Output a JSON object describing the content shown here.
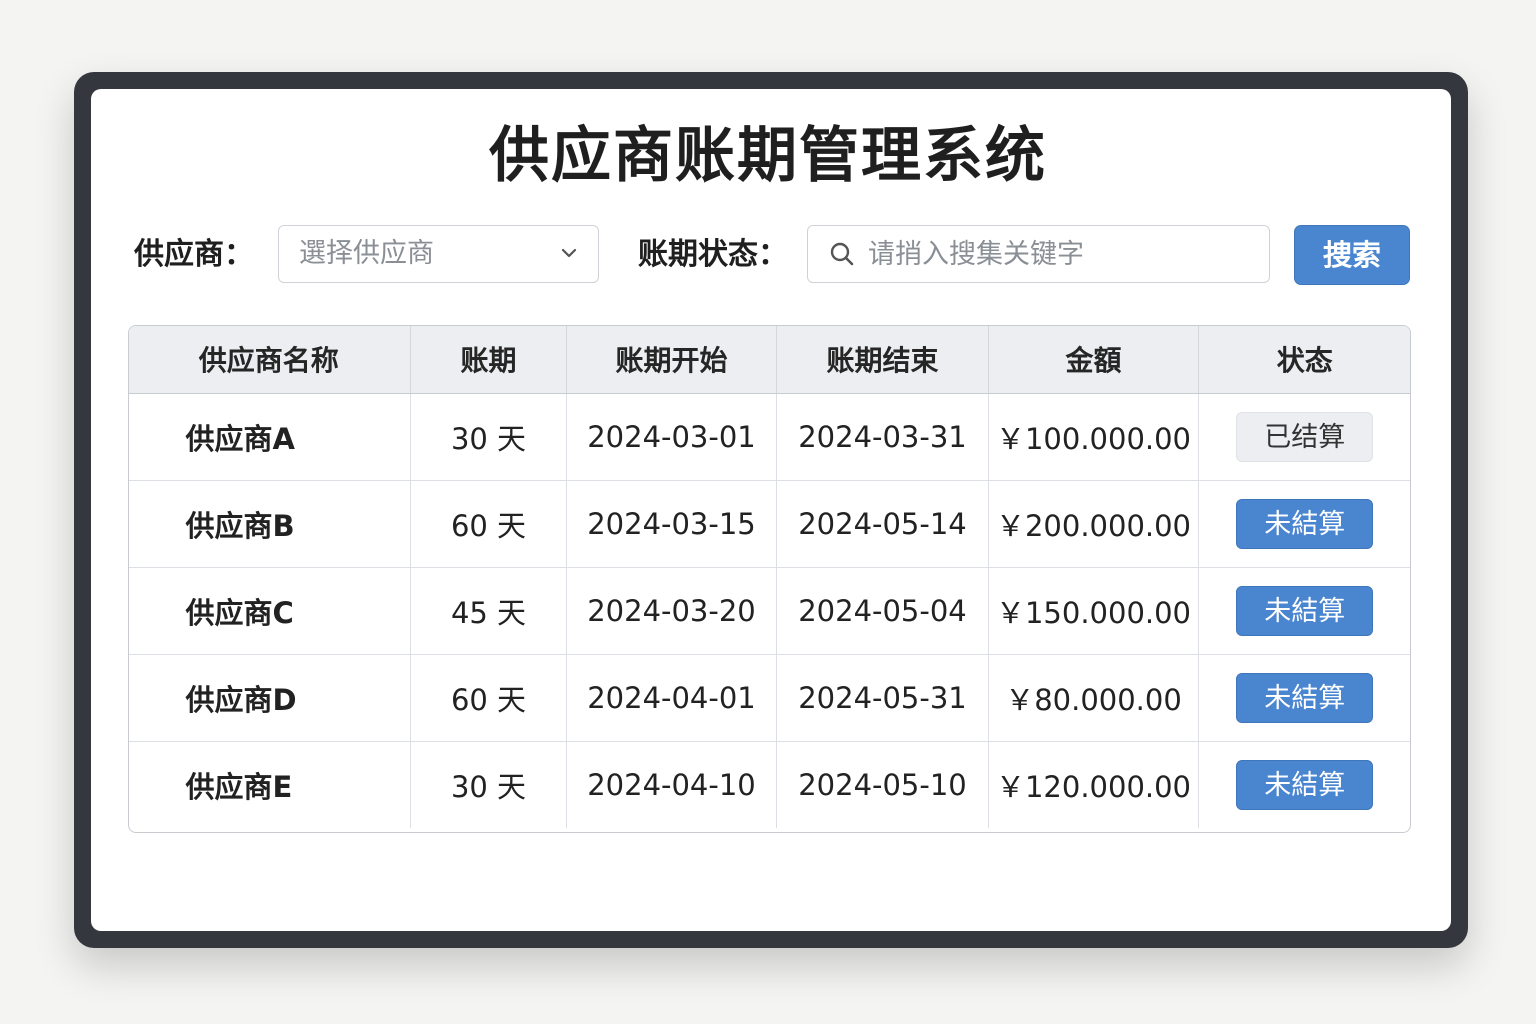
{
  "title": "供应商账期管理系统",
  "filters": {
    "supplier_label": "供应商：",
    "supplier_select_value": "選择供应商",
    "status_label": "账期状态：",
    "search_placeholder": "请捎入搜集关键字",
    "search_button": "捜索"
  },
  "table": {
    "headers": [
      "供应商名称",
      "账期",
      "账期开始",
      "账期结束",
      "金額",
      "状态"
    ],
    "rows": [
      {
        "name": "供应商A",
        "term": "30 天",
        "start": "2024-03-01",
        "end": "2024-03-31",
        "amount": "￥100.000.00",
        "status": "已结算",
        "status_kind": "done"
      },
      {
        "name": "供应商B",
        "term": "60 天",
        "start": "2024-03-15",
        "end": "2024-05-14",
        "amount": "￥200.000.00",
        "status": "未結算",
        "status_kind": "pending"
      },
      {
        "name": "供应商C",
        "term": "45 天",
        "start": "2024-03-20",
        "end": "2024-05-04",
        "amount": "￥150.000.00",
        "status": "未結算",
        "status_kind": "pending"
      },
      {
        "name": "供应商D",
        "term": "60 天",
        "start": "2024-04-01",
        "end": "2024-05-31",
        "amount": "￥80.000.00",
        "status": "未結算",
        "status_kind": "pending"
      },
      {
        "name": "供应商E",
        "term": "30 天",
        "start": "2024-04-10",
        "end": "2024-05-10",
        "amount": "￥120.000.00",
        "status": "未結算",
        "status_kind": "pending"
      }
    ]
  },
  "colors": {
    "accent": "#4a86d0",
    "frame": "#34373d",
    "header_bg": "#eceef1"
  },
  "icons": {
    "select": "chevron-down-icon",
    "search": "search-icon"
  }
}
